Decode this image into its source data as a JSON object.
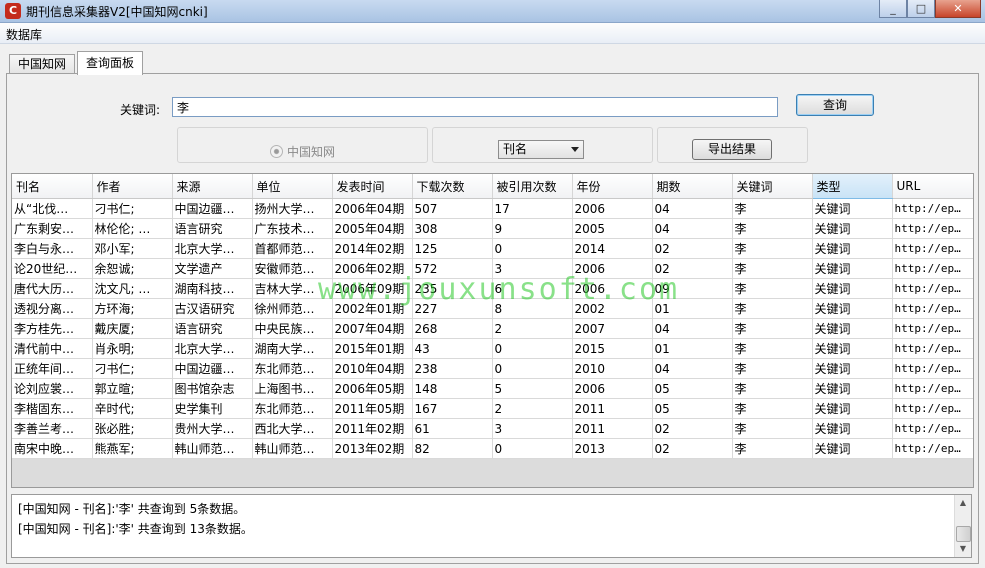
{
  "window": {
    "title": "期刊信息采集器V2[中国知网cnki]",
    "controls": [
      "_",
      "□",
      "✕"
    ]
  },
  "menu": {
    "items": [
      "数据库"
    ]
  },
  "tabs": [
    {
      "label": "中国知网"
    },
    {
      "label": "查询面板"
    }
  ],
  "search": {
    "keyword_label": "关键词:",
    "keyword_value": "李",
    "query_button": "查询",
    "source_radio": "中国知网",
    "field_select": "刊名",
    "export_button": "导出结果"
  },
  "table": {
    "columns": [
      "刊名",
      "作者",
      "来源",
      "单位",
      "发表时间",
      "下载次数",
      "被引用次数",
      "年份",
      "期数",
      "关键词",
      "类型",
      "URL"
    ],
    "rows": [
      [
        "从“北伐…",
        "刁书仁;",
        "中国边疆…",
        "扬州大学…",
        "2006年04期",
        "507",
        "17",
        "2006",
        "04",
        "李",
        "关键词",
        "http://ep…"
      ],
      [
        "广东剩安…",
        "林伦伦;   …",
        "语言研究",
        "广东技术…",
        "2005年04期",
        "308",
        "9",
        "2005",
        "04",
        "李",
        "关键词",
        "http://ep…"
      ],
      [
        "李白与永…",
        "邓小军;",
        "北京大学…",
        "首都师范…",
        "2014年02期",
        "125",
        "0",
        "2014",
        "02",
        "李",
        "关键词",
        "http://ep…"
      ],
      [
        "论20世纪…",
        "余恕诚;",
        "文学遗产",
        "安徽师范…",
        "2006年02期",
        "572",
        "3",
        "2006",
        "02",
        "李",
        "关键词",
        "http://ep…"
      ],
      [
        "唐代大历…",
        "沈文凡;   …",
        "湖南科技…",
        "吉林大学…",
        "2006年09期",
        "235",
        "6",
        "2006",
        "09",
        "李",
        "关键词",
        "http://ep…"
      ],
      [
        "透视分离…",
        "方环海;",
        "古汉语研究",
        "徐州师范…",
        "2002年01期",
        "227",
        "8",
        "2002",
        "01",
        "李",
        "关键词",
        "http://ep…"
      ],
      [
        "李方桂先…",
        "戴庆厦;",
        "语言研究",
        "中央民族…",
        "2007年04期",
        "268",
        "2",
        "2007",
        "04",
        "李",
        "关键词",
        "http://ep…"
      ],
      [
        "清代前中…",
        "肖永明;",
        "北京大学…",
        "湖南大学…",
        "2015年01期",
        "43",
        "0",
        "2015",
        "01",
        "李",
        "关键词",
        "http://ep…"
      ],
      [
        "正统年间…",
        "刁书仁;",
        "中国边疆…",
        "东北师范…",
        "2010年04期",
        "238",
        "0",
        "2010",
        "04",
        "李",
        "关键词",
        "http://ep…"
      ],
      [
        "论刘应裳…",
        "郭立暄;",
        "图书馆杂志",
        "上海图书…",
        "2006年05期",
        "148",
        "5",
        "2006",
        "05",
        "李",
        "关键词",
        "http://ep…"
      ],
      [
        "李楷固东…",
        "辛时代;",
        "史学集刊",
        "东北师范…",
        "2011年05期",
        "167",
        "2",
        "2011",
        "05",
        "李",
        "关键词",
        "http://ep…"
      ],
      [
        "李善兰考…",
        "张必胜;",
        "贵州大学…",
        "西北大学…",
        "2011年02期",
        "61",
        "3",
        "2011",
        "02",
        "李",
        "关键词",
        "http://ep…"
      ],
      [
        "南宋中晚…",
        "熊燕军;",
        "韩山师范…",
        "韩山师范…",
        "2013年02期",
        "82",
        "0",
        "2013",
        "02",
        "李",
        "关键词",
        "http://ep…"
      ]
    ]
  },
  "watermark": "www.jouxunsoft.com",
  "log": {
    "lines": [
      "[中国知网 - 刊名]:'李' 共查询到 5条数据。",
      "[中国知网 - 刊名]:'李' 共查询到 13条数据。"
    ],
    "scroll_up": "▲",
    "scroll_down": "▼"
  }
}
